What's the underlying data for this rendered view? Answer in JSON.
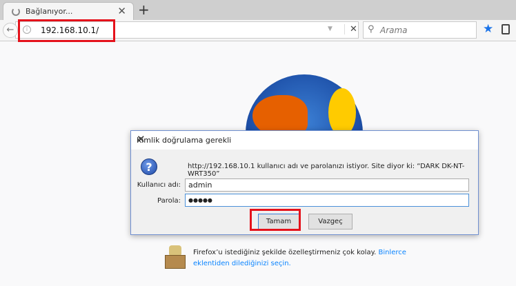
{
  "tab": {
    "title": "Bağlanıyor...",
    "close": "✕",
    "new_tab": "+"
  },
  "nav": {
    "back": "←",
    "url": "192.168.10.1/",
    "info": "i",
    "dropdown": "▼",
    "clear": "✕",
    "search_placeholder": "Arama",
    "search_icon": "🔍",
    "bookmark": "★"
  },
  "dialog": {
    "title": "Kimlik doğrulama gerekli",
    "close": "✕",
    "icon": "?",
    "message": "http://192.168.10.1 kullanıcı adı ve parolanızı istiyor. Site diyor ki: “DARK  DK-NT-WRT350”",
    "username_label": "Kullanıcı adı:",
    "username_value": "admin",
    "password_label": "Parola:",
    "password_value": "●●●●●",
    "ok_label": "Tamam",
    "cancel_label": "Vazgeç"
  },
  "tip": {
    "text": "Firefox’u istediğiniz şekilde özelleştirmeniz çok kolay. ",
    "link": "Binlerce eklentiden dilediğinizi seçin."
  },
  "colors": {
    "highlight": "#e5121b",
    "link": "#0a84ff"
  }
}
